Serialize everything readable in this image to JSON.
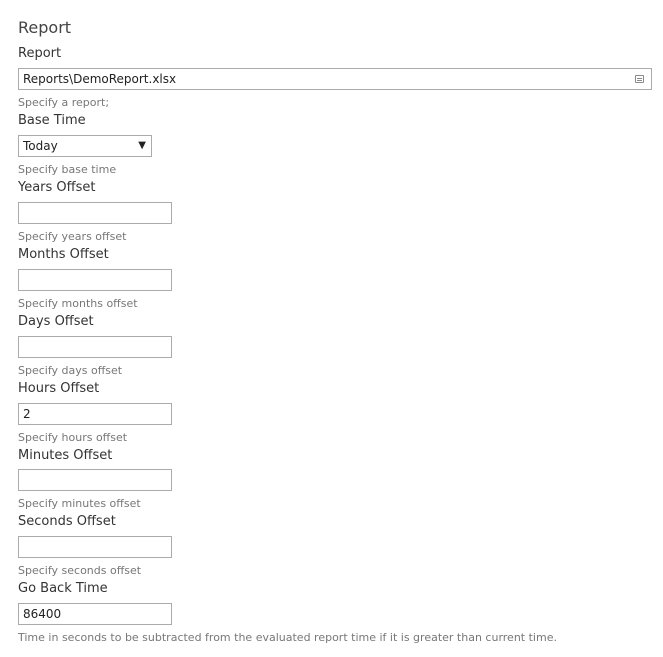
{
  "section_title": "Report",
  "fields": {
    "report": {
      "label": "Report",
      "value": "Reports\\DemoReport.xlsx",
      "hint": "Specify a report;",
      "icon": "browse-icon"
    },
    "base_time": {
      "label": "Base Time",
      "value": "Today",
      "hint": "Specify base time",
      "icon": "dropdown-arrow-icon"
    },
    "years_offset": {
      "label": "Years Offset",
      "value": "",
      "hint": "Specify years offset"
    },
    "months_offset": {
      "label": "Months Offset",
      "value": "",
      "hint": "Specify months offset"
    },
    "days_offset": {
      "label": "Days Offset",
      "value": "",
      "hint": "Specify days offset"
    },
    "hours_offset": {
      "label": "Hours Offset",
      "value": "2",
      "hint": "Specify hours offset"
    },
    "minutes_offset": {
      "label": "Minutes Offset",
      "value": "",
      "hint": "Specify minutes offset"
    },
    "seconds_offset": {
      "label": "Seconds Offset",
      "value": "",
      "hint": "Specify seconds offset"
    },
    "go_back_time": {
      "label": "Go Back Time",
      "value": "86400",
      "hint": "Time in seconds to be subtracted from the evaluated report time if it is greater than current time."
    }
  }
}
